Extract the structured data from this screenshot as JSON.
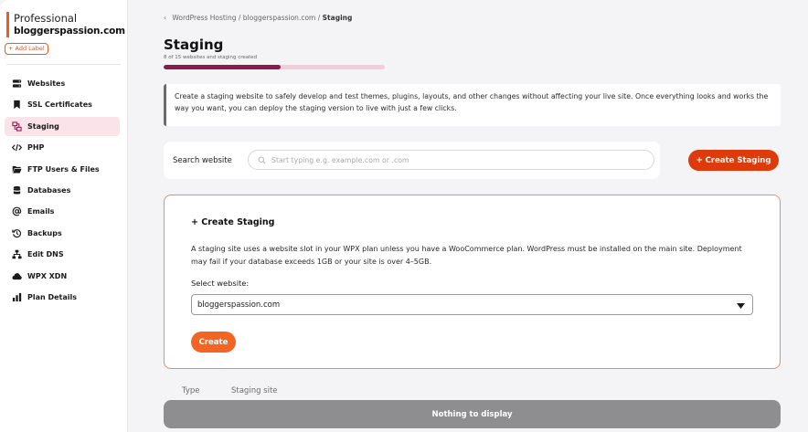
{
  "sidebar": {
    "plan_name": "Professional",
    "site_name": "bloggerspassion.com",
    "add_label": "+ Add Label",
    "items": [
      {
        "label": "Websites",
        "icon": "websites-icon",
        "active": false
      },
      {
        "label": "SSL Certificates",
        "icon": "bookmark-icon",
        "active": false
      },
      {
        "label": "Staging",
        "icon": "staging-icon",
        "active": true
      },
      {
        "label": "PHP",
        "icon": "code-icon",
        "active": false
      },
      {
        "label": "FTP Users & Files",
        "icon": "folder-icon",
        "active": false
      },
      {
        "label": "Databases",
        "icon": "database-icon",
        "active": false
      },
      {
        "label": "Emails",
        "icon": "at-icon",
        "active": false
      },
      {
        "label": "Backups",
        "icon": "history-icon",
        "active": false
      },
      {
        "label": "Edit DNS",
        "icon": "network-icon",
        "active": false
      },
      {
        "label": "WPX XDN",
        "icon": "cloud-icon",
        "active": false
      },
      {
        "label": "Plan Details",
        "icon": "bar-chart-icon",
        "active": false
      }
    ]
  },
  "breadcrumb": {
    "item1": "WordPress Hosting",
    "sep": "/",
    "item2": "bloggerspassion.com",
    "current": "Staging"
  },
  "page": {
    "title": "Staging",
    "subtitle": "8 of 15 websites and staging created",
    "progress": 0.53
  },
  "info": {
    "text": "Create a staging website to safely develop and test themes, plugins, layouts, and other changes without affecting your live site. Once everything looks and works the way you want, you can deploy the staging version to live with just a few clicks."
  },
  "search": {
    "label": "Search website",
    "placeholder": "Start typing e.g. example.com or .com",
    "value": ""
  },
  "create_staging_button": "+ Create Staging",
  "create_card": {
    "title": "+ Create Staging",
    "description": "A staging site uses a website slot in your WPX plan unless you have a WooCommerce plan. WordPress must be installed on the main site. Deployment may fail if your database exceeds 1GB or your site is over 4–5GB.",
    "select_label": "Select website:",
    "selected": "bloggerspassion.com",
    "button": "Create"
  },
  "table": {
    "columns": [
      "Type",
      "Staging site"
    ],
    "empty": "Nothing to display"
  },
  "colors": {
    "accent": "#dd3b0c",
    "button": "#f26523",
    "progress_fill": "#8c1a4a",
    "progress_track": "#f4ccd8",
    "active_nav": "#fbe3ea"
  }
}
